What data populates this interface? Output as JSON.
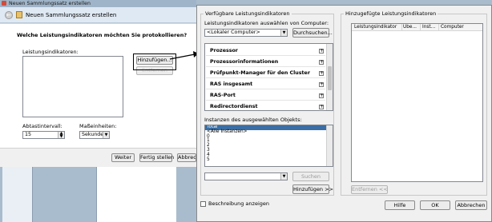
{
  "back_window": {
    "title": "Neuen Sammlungssatz erstellen"
  },
  "wizard": {
    "title": "Neuen Sammlungssatz erstellen",
    "question": "Welche Leistungsindikatoren möchten Sie protokollieren?",
    "counters_label": "Leistungsindikatoren:",
    "add_button": "Hinzufügen...",
    "remove_button": "Entfernen",
    "interval_label": "Abtastintervall:",
    "interval_value": "15",
    "units_label": "Maßeinheiten:",
    "units_value": "Sekunden",
    "next_button": "Weiter",
    "finish_button": "Fertig stellen",
    "cancel_button": "Abbrechen"
  },
  "add_dialog": {
    "available_title": "Verfügbare Leistungsindikatoren",
    "select_from_label": "Leistungsindikatoren auswählen von Computer:",
    "computer_value": "<Lokaler Computer>",
    "browse_button": "Durchsuchen...",
    "counter_groups": [
      "Prozessor",
      "Prozessorinformationen",
      "Prüfpunkt-Manager für den Cluster",
      "RAS insgesamt",
      "RAS-Port",
      "Redirectordienst"
    ],
    "instances_label": "Instanzen des ausgewählten Objekts:",
    "instances": [
      "Total",
      "<Alle Instanzen>",
      "0",
      "1",
      "2",
      "3",
      "4",
      "5"
    ],
    "search_button": "Suchen",
    "add_button": "Hinzufügen >>",
    "added_title": "Hinzugefügte Leistungsindikatoren",
    "added_columns": [
      "Leistungsindikator",
      "Übe...",
      "Inst...",
      "Computer"
    ],
    "remove_button": "Entfernen <<",
    "show_description_label": "Beschreibung anzeigen",
    "help_button": "Hilfe",
    "ok_button": "OK",
    "cancel_button": "Abbrechen"
  }
}
